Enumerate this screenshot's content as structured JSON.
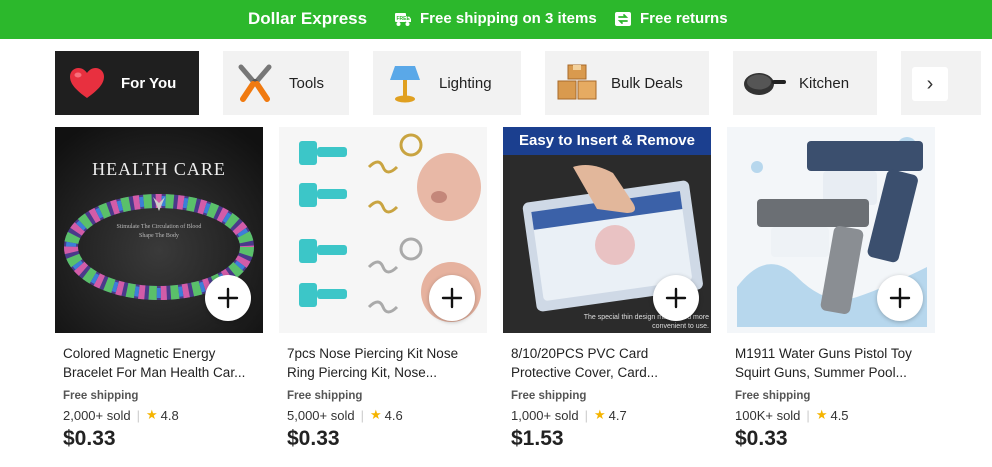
{
  "banner": {
    "brand": "Dollar Express",
    "shipping": "Free shipping on 3 items",
    "returns": "Free returns"
  },
  "categories": [
    {
      "label": "For You",
      "icon": "heart-icon"
    },
    {
      "label": "Tools",
      "icon": "pliers-icon"
    },
    {
      "label": "Lighting",
      "icon": "lamp-icon"
    },
    {
      "label": "Bulk Deals",
      "icon": "boxes-icon"
    },
    {
      "label": "Kitchen",
      "icon": "frying-pan-icon"
    }
  ],
  "products": [
    {
      "image_text": "HEALTH CARE",
      "image_caption": "Stimulate The Circulation of Blood Shape The Body",
      "title": "Colored Magnetic Energy Bracelet For Man Health Car...",
      "shipping": "Free shipping",
      "sold": "2,000+ sold",
      "rating": "4.8",
      "price": "$0.33"
    },
    {
      "title": "7pcs Nose Piercing Kit Nose Ring Piercing Kit, Nose...",
      "shipping": "Free shipping",
      "sold": "5,000+ sold",
      "rating": "4.6",
      "price": "$0.33"
    },
    {
      "image_text": "Easy to Insert & Remove",
      "image_caption": "The special thin design makes you more convenient to use.",
      "title": "8/10/20PCS PVC Card Protective Cover, Card...",
      "shipping": "Free shipping",
      "sold": "1,000+ sold",
      "rating": "4.7",
      "price": "$1.53"
    },
    {
      "title": "M1911 Water Guns Pistol Toy Squirt Guns, Summer Pool...",
      "shipping": "Free shipping",
      "sold": "100K+ sold",
      "rating": "4.5",
      "price": "$0.33"
    }
  ],
  "colors": {
    "brand_green": "#2cb82c",
    "active_tab": "#1f1f1f",
    "star": "#f5b400"
  }
}
